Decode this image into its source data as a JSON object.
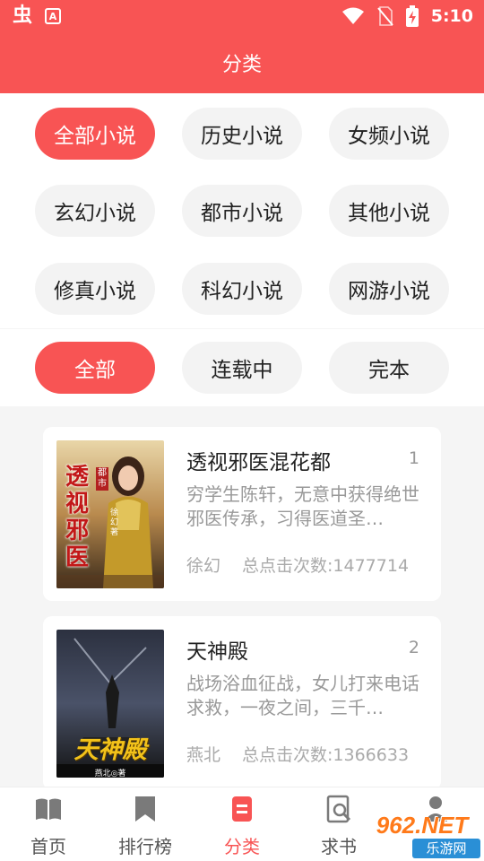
{
  "status_bar": {
    "time": "5:10",
    "app_icon": "chong-glyph",
    "notification_icon": "a-box-icon",
    "icons": [
      "wifi-icon",
      "no-sim-icon",
      "battery-charging-icon"
    ]
  },
  "header": {
    "title": "分类"
  },
  "categories": [
    {
      "label": "全部小说",
      "active": true
    },
    {
      "label": "历史小说"
    },
    {
      "label": "女频小说"
    },
    {
      "label": "玄幻小说"
    },
    {
      "label": "都市小说"
    },
    {
      "label": "其他小说"
    },
    {
      "label": "修真小说"
    },
    {
      "label": "科幻小说"
    },
    {
      "label": "网游小说"
    }
  ],
  "status_filters": [
    {
      "label": "全部",
      "active": true
    },
    {
      "label": "连载中"
    },
    {
      "label": "完本"
    }
  ],
  "books": [
    {
      "title": "透视邪医混花都",
      "rank": "1",
      "desc": "穷学生陈轩，无意中获得绝世邪医传承，习得医道圣…",
      "category": "徐幻",
      "clicks": "总点击次数:1477714",
      "cover": {
        "title_text": "透视邪医",
        "author_text": "徐幻 著",
        "series_text": "都市"
      }
    },
    {
      "title": "天神殿",
      "rank": "2",
      "desc": "战场浴血征战，女儿打来电话求救，一夜之间，三千…",
      "category": "燕北",
      "clicks": "总点击次数:1366633",
      "cover": {
        "title_text": "天神殿",
        "author_text": "燕北◎著"
      }
    }
  ],
  "tabs": [
    {
      "label": "首页",
      "icon": "book-open-icon"
    },
    {
      "label": "排行榜",
      "icon": "bookmark-icon"
    },
    {
      "label": "分类",
      "icon": "category-doc-icon",
      "active": true
    },
    {
      "label": "求书",
      "icon": "search-book-icon"
    },
    {
      "label": "",
      "icon": "person-icon"
    }
  ],
  "watermark": {
    "brand": "962.NET",
    "site": "乐游网"
  },
  "colors": {
    "accent": "#f85454",
    "chip_bg": "#f3f3f3",
    "page_bg": "#f5f5f5"
  }
}
